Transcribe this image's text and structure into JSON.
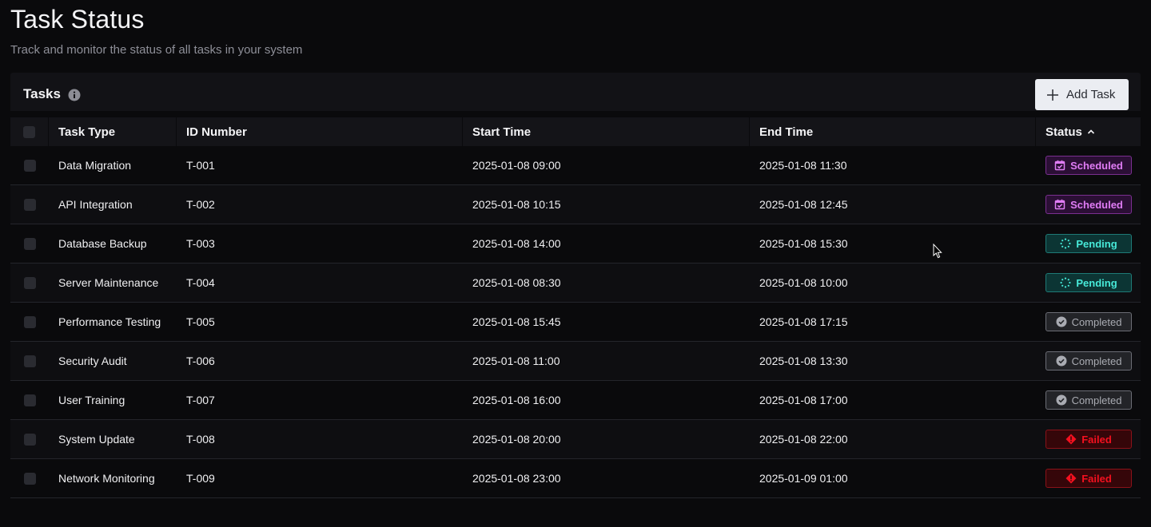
{
  "page": {
    "title": "Task Status",
    "subtitle": "Track and monitor the status of all tasks in your system"
  },
  "card": {
    "title": "Tasks",
    "info_icon": "info-icon",
    "add_button_label": "Add Task"
  },
  "columns": [
    "Task Type",
    "ID Number",
    "Start Time",
    "End Time",
    "Status"
  ],
  "sort": {
    "column": "Status",
    "direction": "ascending"
  },
  "rows": [
    {
      "type": "Data Migration",
      "id": "T-001",
      "start": "2025-01-08 09:00",
      "end": "2025-01-08 11:30",
      "status": "Scheduled",
      "kind": "scheduled"
    },
    {
      "type": "API Integration",
      "id": "T-002",
      "start": "2025-01-08 10:15",
      "end": "2025-01-08 12:45",
      "status": "Scheduled",
      "kind": "scheduled"
    },
    {
      "type": "Database Backup",
      "id": "T-003",
      "start": "2025-01-08 14:00",
      "end": "2025-01-08 15:30",
      "status": "Pending",
      "kind": "pending"
    },
    {
      "type": "Server Maintenance",
      "id": "T-004",
      "start": "2025-01-08 08:30",
      "end": "2025-01-08 10:00",
      "status": "Pending",
      "kind": "pending"
    },
    {
      "type": "Performance Testing",
      "id": "T-005",
      "start": "2025-01-08 15:45",
      "end": "2025-01-08 17:15",
      "status": "Completed",
      "kind": "completed"
    },
    {
      "type": "Security Audit",
      "id": "T-006",
      "start": "2025-01-08 11:00",
      "end": "2025-01-08 13:30",
      "status": "Completed",
      "kind": "completed"
    },
    {
      "type": "User Training",
      "id": "T-007",
      "start": "2025-01-08 16:00",
      "end": "2025-01-08 17:00",
      "status": "Completed",
      "kind": "completed"
    },
    {
      "type": "System Update",
      "id": "T-008",
      "start": "2025-01-08 20:00",
      "end": "2025-01-08 22:00",
      "status": "Failed",
      "kind": "failed"
    },
    {
      "type": "Network Monitoring",
      "id": "T-009",
      "start": "2025-01-08 23:00",
      "end": "2025-01-09 01:00",
      "status": "Failed",
      "kind": "failed"
    }
  ],
  "status_icons": {
    "scheduled": "calendar-check-icon",
    "pending": "spinner-icon",
    "completed": "check-circle-icon",
    "failed": "error-diamond-icon"
  },
  "colors": {
    "background": "#0a0a0c",
    "scheduled": "#e07cf5",
    "pending": "#47ead9",
    "completed": "#a9abb2",
    "failed": "#f4101f"
  }
}
